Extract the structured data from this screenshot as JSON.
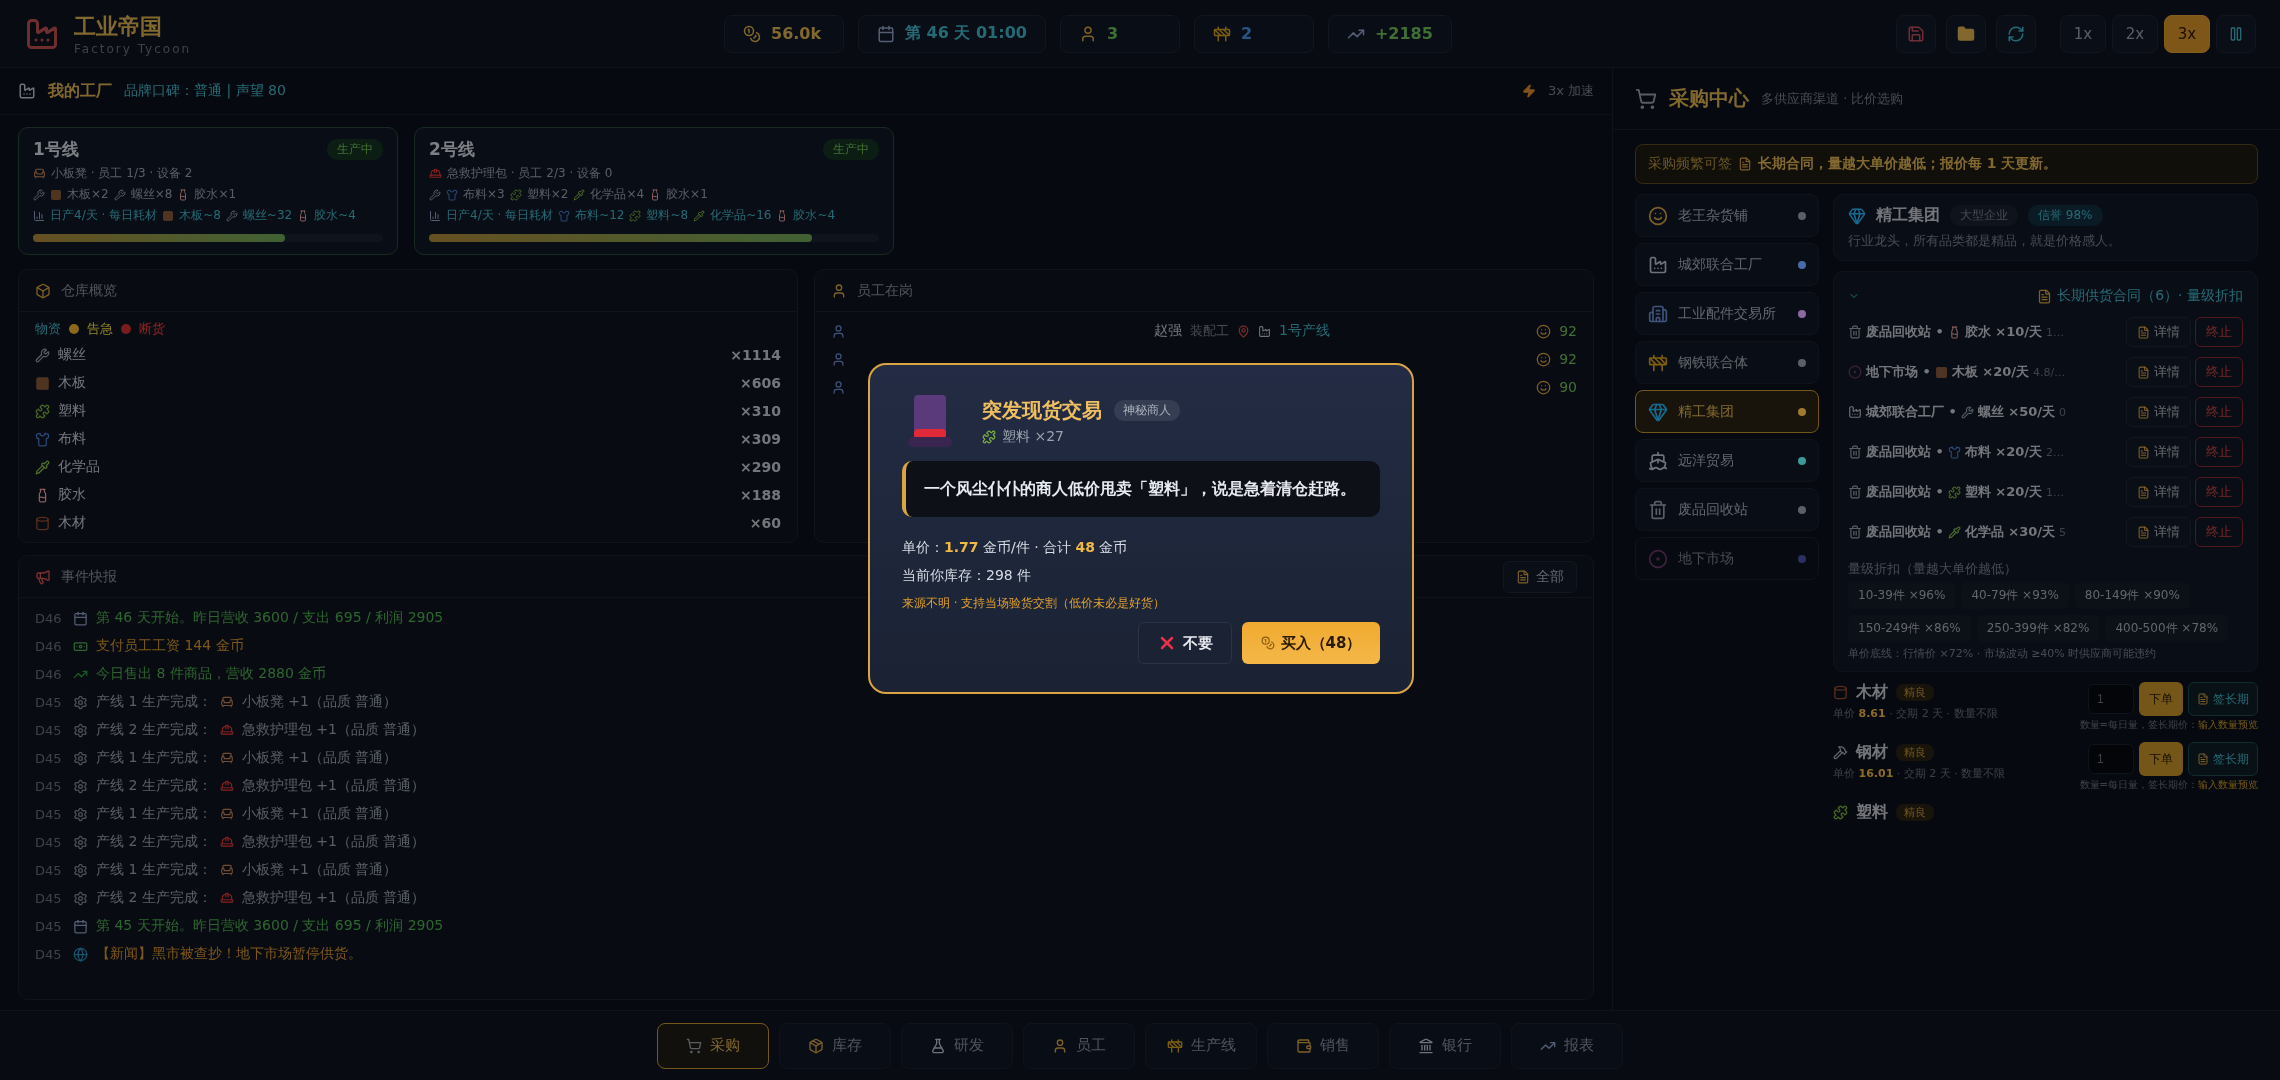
{
  "app": {
    "title": "工业帝国",
    "subtitle": "Factory Tycoon"
  },
  "stats": [
    {
      "kind": "coin",
      "value": "56.0k"
    },
    {
      "kind": "calendar",
      "value": "第 46 天 01:00"
    },
    {
      "kind": "worker",
      "value": "3"
    },
    {
      "kind": "crane",
      "value": "2"
    },
    {
      "kind": "chart",
      "value": "+2185"
    }
  ],
  "speeds": [
    {
      "label": "1x",
      "selected": false
    },
    {
      "label": "2x",
      "selected": false
    },
    {
      "label": "3x",
      "selected": true
    }
  ],
  "factory": {
    "title": "我的工厂",
    "reputation": "品牌口碑：普通 | 声望 80",
    "speed": "3x 加速"
  },
  "lines": [
    {
      "name": "1号线",
      "status": "生产中",
      "kind": "stool",
      "info": "小板凳 · 员工 1/3 · 设备 2",
      "recipe": [
        {
          "kind": "board",
          "text": "木板×2"
        },
        {
          "kind": "screw",
          "text": "螺丝×8"
        },
        {
          "kind": "glue",
          "text": "胶水×1"
        }
      ],
      "daily_label": "日产4/天 · 每日耗材",
      "daily": [
        {
          "kind": "board",
          "text": "木板~8"
        },
        {
          "kind": "screw",
          "text": "螺丝~32"
        },
        {
          "kind": "glue",
          "text": "胶水~4"
        }
      ],
      "level": 0.72
    },
    {
      "name": "2号线",
      "status": "生产中",
      "kind": "medkit",
      "info": "急救护理包 · 员工 2/3 · 设备 0",
      "recipe": [
        {
          "kind": "cloth",
          "text": "布料×3"
        },
        {
          "kind": "plastic",
          "text": "塑料×2"
        },
        {
          "kind": "chemical",
          "text": "化学品×4"
        },
        {
          "kind": "glue",
          "text": "胶水×1"
        }
      ],
      "daily_label": "日产4/天 · 每日耗材",
      "daily": [
        {
          "kind": "cloth",
          "text": "布料~12"
        },
        {
          "kind": "plastic",
          "text": "塑料~8"
        },
        {
          "kind": "chemical",
          "text": "化学品~16"
        },
        {
          "kind": "glue",
          "text": "胶水~4"
        }
      ],
      "level": 0.85
    }
  ],
  "warehouse": {
    "title": "仓库概览",
    "legend": [
      {
        "label": "物资",
        "kind": "plain"
      },
      {
        "label": "告急",
        "kind": "dot",
        "color": "#8a6a1a"
      },
      {
        "label": "断货",
        "kind": "dot",
        "color": "#7a1c1c"
      }
    ],
    "items": [
      {
        "kind": "screw",
        "name": "螺丝",
        "count": "×1114"
      },
      {
        "kind": "board",
        "name": "木板",
        "count": "×606"
      },
      {
        "kind": "plastic",
        "name": "塑料",
        "count": "×310"
      },
      {
        "kind": "cloth",
        "name": "布料",
        "count": "×309"
      },
      {
        "kind": "chemical",
        "name": "化学品",
        "count": "×290"
      },
      {
        "kind": "glue",
        "name": "胶水",
        "count": "×188"
      },
      {
        "kind": "wood",
        "name": "木材",
        "count": "×60"
      }
    ]
  },
  "employees": {
    "title": "员工在岗",
    "rows": [
      {
        "name": "赵强",
        "role": "装配工",
        "line": "1号产线",
        "score": "92"
      },
      {
        "score": "92"
      },
      {
        "score": "90"
      }
    ]
  },
  "events": {
    "title": "事件快报",
    "filter": "全部",
    "rows": [
      {
        "day": "D46",
        "kind": "start",
        "text": "第 46 天开始。昨日营收 3600 / 支出 695 / 利润 2905"
      },
      {
        "day": "D46",
        "kind": "wage",
        "text": "支付员工工资 144 金币"
      },
      {
        "day": "D46",
        "kind": "sale",
        "text": "今日售出 8 件商品，营收 2880 金币"
      },
      {
        "day": "D45",
        "kind": "stool",
        "text": "产线 1 生产完成：",
        "item": "小板凳 +1（品质 普通）"
      },
      {
        "day": "D45",
        "kind": "medkit",
        "text": "产线 2 生产完成：",
        "item": "急救护理包 +1（品质 普通）"
      },
      {
        "day": "D45",
        "kind": "stool",
        "text": "产线 1 生产完成：",
        "item": "小板凳 +1（品质 普通）"
      },
      {
        "day": "D45",
        "kind": "medkit",
        "text": "产线 2 生产完成：",
        "item": "急救护理包 +1（品质 普通）"
      },
      {
        "day": "D45",
        "kind": "stool",
        "text": "产线 1 生产完成：",
        "item": "小板凳 +1（品质 普通）"
      },
      {
        "day": "D45",
        "kind": "medkit",
        "text": "产线 2 生产完成：",
        "item": "急救护理包 +1（品质 普通）"
      },
      {
        "day": "D45",
        "kind": "stool",
        "text": "产线 1 生产完成：",
        "item": "小板凳 +1（品质 普通）"
      },
      {
        "day": "D45",
        "kind": "medkit",
        "text": "产线 2 生产完成：",
        "item": "急救护理包 +1（品质 普通）"
      },
      {
        "day": "D45",
        "kind": "start",
        "text": "第 45 天开始。昨日营收 3600 / 支出 695 / 利润 2905"
      },
      {
        "day": "D45",
        "kind": "news",
        "text": "【新闻】黑市被查抄！地下市场暂停供货。"
      }
    ]
  },
  "purchase": {
    "title": "采购中心",
    "subtitle": "多供应商渠道 · 比价选购",
    "notice_lead": "采购频繁可签",
    "notice_main": "长期合同，量越大单价越低；报价每 1 天更新。"
  },
  "suppliers": [
    {
      "kind": "grocer",
      "name": "老王杂货铺",
      "color": "#5a5f68",
      "selected": false,
      "disabled": false
    },
    {
      "kind": "factory",
      "name": "城郊联合工厂",
      "color": "#4a6aa8",
      "selected": false,
      "disabled": false
    },
    {
      "kind": "exchange",
      "name": "工业配件交易所",
      "color": "#8a6aa0",
      "selected": false,
      "disabled": false
    },
    {
      "kind": "steel",
      "name": "钢铁联合体",
      "color": "#5a5f68",
      "selected": false,
      "disabled": false
    },
    {
      "kind": "gem",
      "name": "精工集团",
      "color": "#a07a30",
      "selected": true,
      "disabled": false
    },
    {
      "kind": "ship",
      "name": "远洋贸易",
      "color": "#3a9a9a",
      "selected": false,
      "disabled": false
    },
    {
      "kind": "bin",
      "name": "废品回收站",
      "color": "#5a5f68",
      "selected": false,
      "disabled": false
    },
    {
      "kind": "market",
      "name": "地下市场",
      "color": "#2a3060",
      "selected": false,
      "disabled": true
    }
  ],
  "supplier_detail": {
    "kind": "gem",
    "name": "精工集团",
    "tags": [
      {
        "kind": "type",
        "label": "大型企业"
      },
      {
        "kind": "credit",
        "label": "信誉 98%"
      }
    ],
    "description": "行业龙头，所有品类都是精品，就是价格感人。"
  },
  "contracts": {
    "title": "长期供货合同（6）· 量级折扣",
    "expanded": true,
    "rows": [
      {
        "supplier": {
          "kind": "bin",
          "name": "废品回收站 •"
        },
        "material": {
          "kind": "glue",
          "text": "胶水 ×10/天"
        },
        "extra": "1…",
        "detail": "详情",
        "stop": "终止"
      },
      {
        "supplier": {
          "kind": "market",
          "name": "地下市场 •"
        },
        "material": {
          "kind": "board",
          "text": "木板 ×20/天"
        },
        "extra": "4.8/…",
        "detail": "详情",
        "stop": "终止"
      },
      {
        "supplier": {
          "kind": "factory",
          "name": "城郊联合工厂 •"
        },
        "material": {
          "kind": "screw",
          "text": "螺丝 ×50/天"
        },
        "extra": "0",
        "detail": "详情",
        "stop": "终止"
      },
      {
        "supplier": {
          "kind": "bin",
          "name": "废品回收站 •"
        },
        "material": {
          "kind": "cloth",
          "text": "布料 ×20/天"
        },
        "extra": "2…",
        "detail": "详情",
        "stop": "终止"
      },
      {
        "supplier": {
          "kind": "bin",
          "name": "废品回收站 •"
        },
        "material": {
          "kind": "plastic",
          "text": "塑料 ×20/天"
        },
        "extra": "1…",
        "detail": "详情",
        "stop": "终止"
      },
      {
        "supplier": {
          "kind": "bin",
          "name": "废品回收站 •"
        },
        "material": {
          "kind": "chemical",
          "text": "化学品 ×30/天"
        },
        "extra": "5",
        "detail": "详情",
        "stop": "终止"
      }
    ],
    "tiers_title": "量级折扣（量越大单价越低）",
    "tiers": [
      "10-39件 ×96%",
      "40-79件 ×93%",
      "80-149件 ×90%",
      "150-249件 ×86%",
      "250-399件 ×82%",
      "400-500件 ×78%"
    ],
    "floor": "单价底线：行情价 ×72% · 市场波动 ≥40% 时供应商可能违约"
  },
  "products": [
    {
      "kind": "wood",
      "name": "木材",
      "grade": "精良",
      "price": "单价 **8.61** · 交期 2 天 · 数量不限",
      "qty": "1",
      "order": "下单",
      "sign": "签长期",
      "hint": "数量=每日量，签长期价：",
      "hint_link": "输入数量预览"
    },
    {
      "kind": "steel",
      "name": "钢材",
      "grade": "精良",
      "price": "单价 **16.01** · 交期 2 天 · 数量不限",
      "qty": "1",
      "order": "下单",
      "sign": "签长期",
      "hint": "数量=每日量，签长期价：",
      "hint_link": "输入数量预览"
    },
    {
      "kind": "plastic",
      "name": "塑料",
      "grade": "精良"
    }
  ],
  "nav": [
    {
      "kind": "cart",
      "label": "采购",
      "selected": true
    },
    {
      "kind": "box",
      "label": "库存",
      "selected": false
    },
    {
      "kind": "lab",
      "label": "研发",
      "selected": false
    },
    {
      "kind": "worker",
      "label": "员工",
      "selected": false
    },
    {
      "kind": "crane",
      "label": "生产线",
      "selected": false
    },
    {
      "kind": "money",
      "label": "销售",
      "selected": false
    },
    {
      "kind": "bank",
      "label": "银行",
      "selected": false
    },
    {
      "kind": "chart",
      "label": "报表",
      "selected": false
    }
  ],
  "modal": {
    "title": "突发现货交易",
    "tag": "神秘商人",
    "item": {
      "kind": "plastic",
      "text": "塑料 ×27"
    },
    "quote": "一个风尘仆仆的商人低价甩卖「塑料」，说是急着清仓赶路。",
    "price": "单价：**1.77** 金币/件 · 合计 **48** 金币",
    "stock": "当前你库存：298 件",
    "warning": "来源不明 · 支持当场验货交割（低价未必是好货）",
    "decline": "不要",
    "accept": "买入（48）"
  }
}
